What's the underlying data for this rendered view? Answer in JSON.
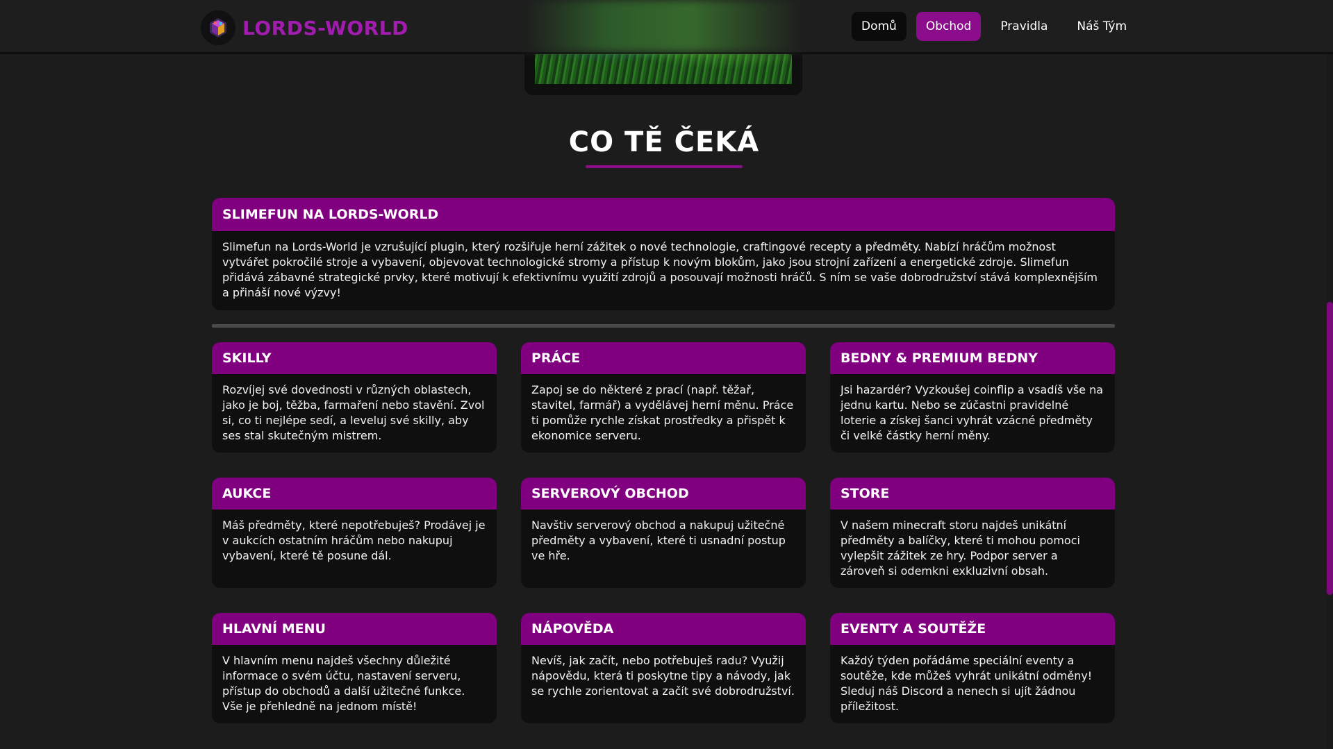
{
  "brand": {
    "name": "LORDS-WORLD",
    "logo_icon": "lords-world-logo-icon"
  },
  "nav": [
    {
      "label": "Domů",
      "state": "active"
    },
    {
      "label": "Obchod",
      "state": "highlighted"
    },
    {
      "label": "Pravidla",
      "state": "normal"
    },
    {
      "label": "Náš Tým",
      "state": "normal"
    }
  ],
  "section": {
    "title": "CO TĚ ČEKÁ"
  },
  "featured": {
    "title": "SLIMEFUN NA LORDS-WORLD",
    "text": "Slimefun na Lords-World je vzrušující plugin, který rozšiřuje herní zážitek o nové technologie, craftingové recepty a předměty. Nabízí hráčům možnost vytvářet pokročilé stroje a vybavení, objevovat technologické stromy a přístup k novým blokům, jako jsou strojní zařízení a energetické zdroje. Slimefun přidává zábavné strategické prvky, které motivují k efektivnímu využití zdrojů a posouvají možnosti hráčů. S ním se vaše dobrodružství stává komplexnějším a přináší nové výzvy!"
  },
  "cards": [
    {
      "title": "SKILLY",
      "text": "Rozvíjej své dovednosti v různých oblastech, jako je boj, těžba, farmaření nebo stavění. Zvol si, co ti nejlépe sedí, a leveluj své skilly, aby ses stal skutečným mistrem."
    },
    {
      "title": "PRÁCE",
      "text": "Zapoj se do některé z prací (např. těžař, stavitel, farmář) a vydělávej herní měnu. Práce ti pomůže rychle získat prostředky a přispět k ekonomice serveru."
    },
    {
      "title": "BEDNY & PREMIUM BEDNY",
      "text": "Jsi hazardér? Vyzkoušej coinflip a vsadíš vše na jednu kartu. Nebo se zúčastni pravidelné loterie a získej šanci vyhrát vzácné předměty či velké částky herní měny."
    },
    {
      "title": "AUKCE",
      "text": "Máš předměty, které nepotřebuješ? Prodávej je v aukcích ostatním hráčům nebo nakupuj vybavení, které tě posune dál."
    },
    {
      "title": "SERVEROVÝ OBCHOD",
      "text": "Navštiv serverový obchod a nakupuj užitečné předměty a vybavení, které ti usnadní postup ve hře."
    },
    {
      "title": "STORE",
      "text": "V našem minecraft storu najdeš unikátní předměty a balíčky, které ti mohou pomoci vylepšit zážitek ze hry. Podpor server a zároveň si odemkni exkluzivní obsah."
    },
    {
      "title": "HLAVNÍ MENU",
      "text": "V hlavním menu najdeš všechny důležité informace o svém účtu, nastavení serveru, přístup do obchodů a další užitečné funkce. Vše je přehledně na jednom místě!"
    },
    {
      "title": "NÁPOVĚDA",
      "text": "Nevíš, jak začít, nebo potřebuješ radu? Využij nápovědu, která ti poskytne tipy a návody, jak se rychle zorientovat a začít své dobrodružství."
    },
    {
      "title": "EVENTY A SOUTĚŽE",
      "text": "Každý týden pořádáme speciální eventy a soutěže, kde můžeš vyhrát unikátní odměny! Sleduj náš Discord a nenech si ujít žádnou příležitost."
    }
  ],
  "colors": {
    "accent": "#800080",
    "background": "#1c1c1c",
    "card": "#0f0f0f"
  }
}
